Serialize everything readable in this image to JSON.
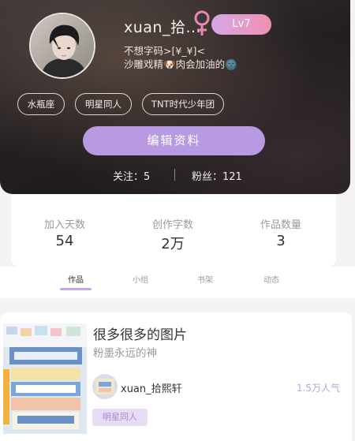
{
  "profile": {
    "username": "xuan_拾...",
    "level": "Lv7",
    "bio_line1": "不想字码>[¥_¥]<",
    "bio_line2": "沙雕戏精🐶肉会加油的🌚",
    "tags": [
      "水瓶座",
      "明星同人",
      "TNT时代少年团"
    ],
    "edit_button": "编辑资料",
    "following_label": "关注：",
    "following_count": "5",
    "followers_label": "粉丝：",
    "followers_count": "121"
  },
  "stats": [
    {
      "label": "加入天数",
      "value": "54"
    },
    {
      "label": "创作字数",
      "value": "2万"
    },
    {
      "label": "作品数量",
      "value": "3"
    }
  ],
  "tabs": [
    {
      "label": "作品",
      "active": true
    },
    {
      "label": "小组",
      "active": false
    },
    {
      "label": "书架",
      "active": false
    },
    {
      "label": "动态",
      "active": false
    }
  ],
  "work": {
    "title": "很多很多的图片",
    "subtitle": "粉墨永远的神",
    "author": "xuan_拾熙轩",
    "popularity": "1.5万人气",
    "tag": "明星同人"
  },
  "colors": {
    "accent": "#b89ae3",
    "gender": "#e58ab5",
    "level_gradient_start": "#d6a7e8",
    "level_gradient_end": "#f08fb0"
  }
}
